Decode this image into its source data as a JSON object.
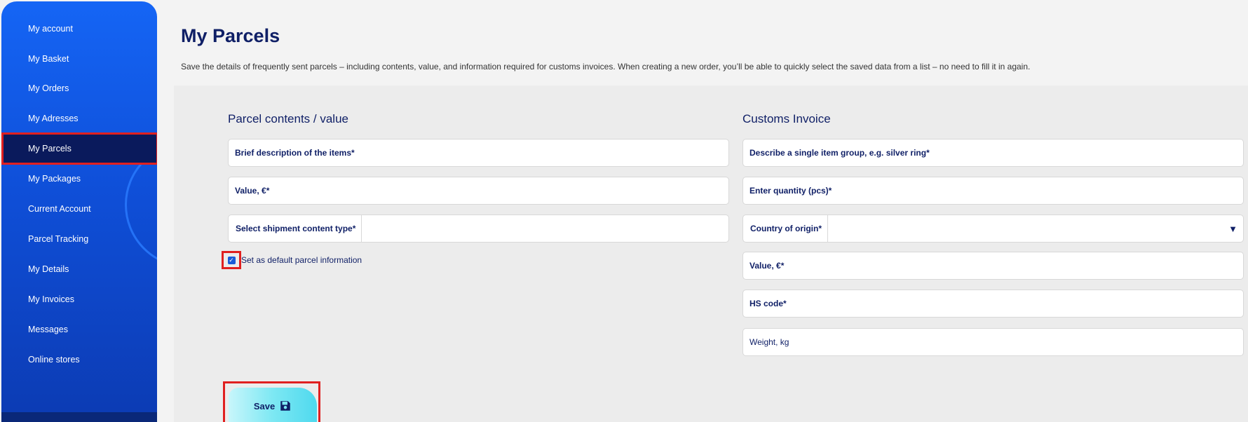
{
  "sidebar": {
    "items": [
      {
        "label": "My account"
      },
      {
        "label": "My Basket"
      },
      {
        "label": "My Orders"
      },
      {
        "label": "My Adresses"
      },
      {
        "label": "My Parcels"
      },
      {
        "label": "My Packages"
      },
      {
        "label": "Current Account"
      },
      {
        "label": "Parcel Tracking"
      },
      {
        "label": "My Details"
      },
      {
        "label": "My Invoices"
      },
      {
        "label": "Messages"
      },
      {
        "label": "Online stores"
      }
    ],
    "active_item": "My Parcels"
  },
  "header": {
    "title": "My Parcels",
    "description": "Save the details of frequently sent parcels – including contents, value, and information required for customs invoices. When creating a new order, you’ll be able to quickly select the saved data from a list – no need to fill it in again."
  },
  "parcel_contents": {
    "title": "Parcel contents / value",
    "description_placeholder": "Brief description of the items*",
    "value_placeholder": "Value, €*",
    "content_type_label": "Select shipment content type*",
    "content_type_value": "",
    "default_checkbox_label": "Set as default parcel information",
    "default_checked": true
  },
  "customs_invoice": {
    "title": "Customs Invoice",
    "item_group_placeholder": "Describe a single item group, e.g. silver ring*",
    "quantity_placeholder": "Enter quantity (pcs)*",
    "country_label": "Country of origin*",
    "country_value": "",
    "value_placeholder": "Value, €*",
    "hs_code_placeholder": "HS code*",
    "weight_placeholder": "Weight, kg"
  },
  "actions": {
    "save_label": "Save"
  },
  "colors": {
    "sidebar": "#1565f5",
    "sidebar_active": "#0a1a5c",
    "text_primary": "#0f1f66",
    "highlight": "#e02020",
    "save_button": "#7de8f3"
  }
}
